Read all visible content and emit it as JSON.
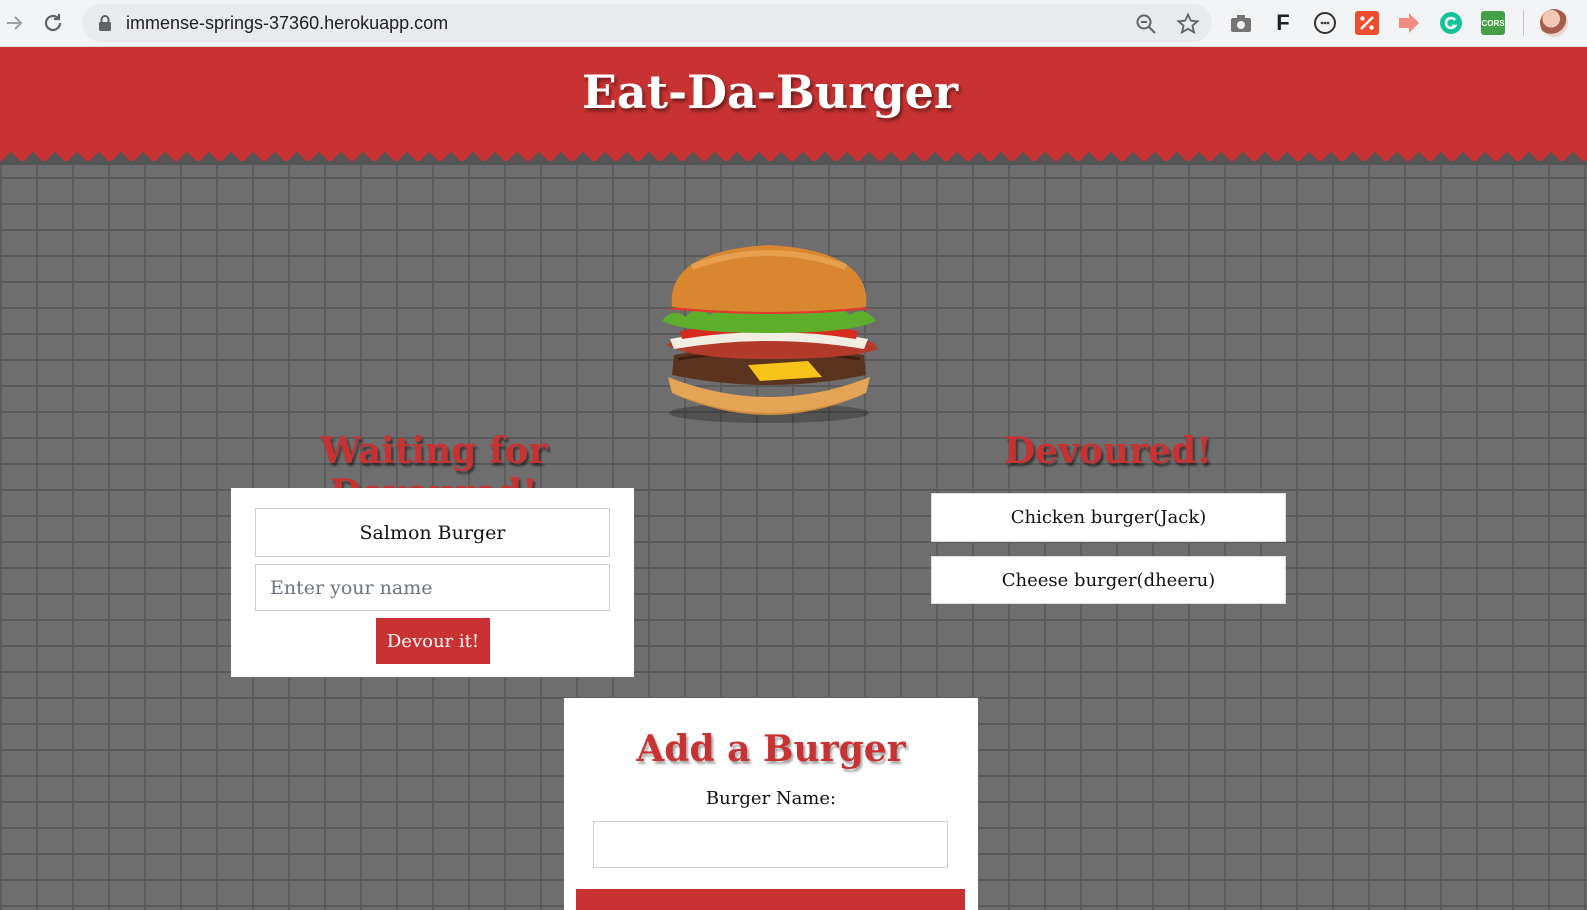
{
  "browser": {
    "url": "immense-springs-37360.herokuapp.com",
    "icons": [
      "forward-icon",
      "reload-icon",
      "lock-icon",
      "zoom-icon",
      "bookmark-star-icon",
      "camera-extension-icon",
      "f-extension-icon",
      "json-extension-icon",
      "percent-extension-icon",
      "arrow-extension-icon",
      "grammarly-extension-icon",
      "cors-extension-icon",
      "profile-avatar"
    ],
    "ext_f": "F",
    "ext_cors": "CORS"
  },
  "header": {
    "title": "Eat-Da-Burger",
    "color": "#c83232"
  },
  "waiting": {
    "title": "Waiting for Devoured!",
    "items": [
      {
        "name": "Salmon Burger",
        "name_placeholder": "Enter your name",
        "button_label": "Devour it!"
      }
    ]
  },
  "devoured": {
    "title": "Devoured!",
    "items": [
      {
        "label": "Chicken burger(Jack)"
      },
      {
        "label": "Cheese burger(dheeru)"
      }
    ]
  },
  "add_burger": {
    "title": "Add a Burger",
    "field_label": "Burger Name:",
    "field_value": ""
  }
}
